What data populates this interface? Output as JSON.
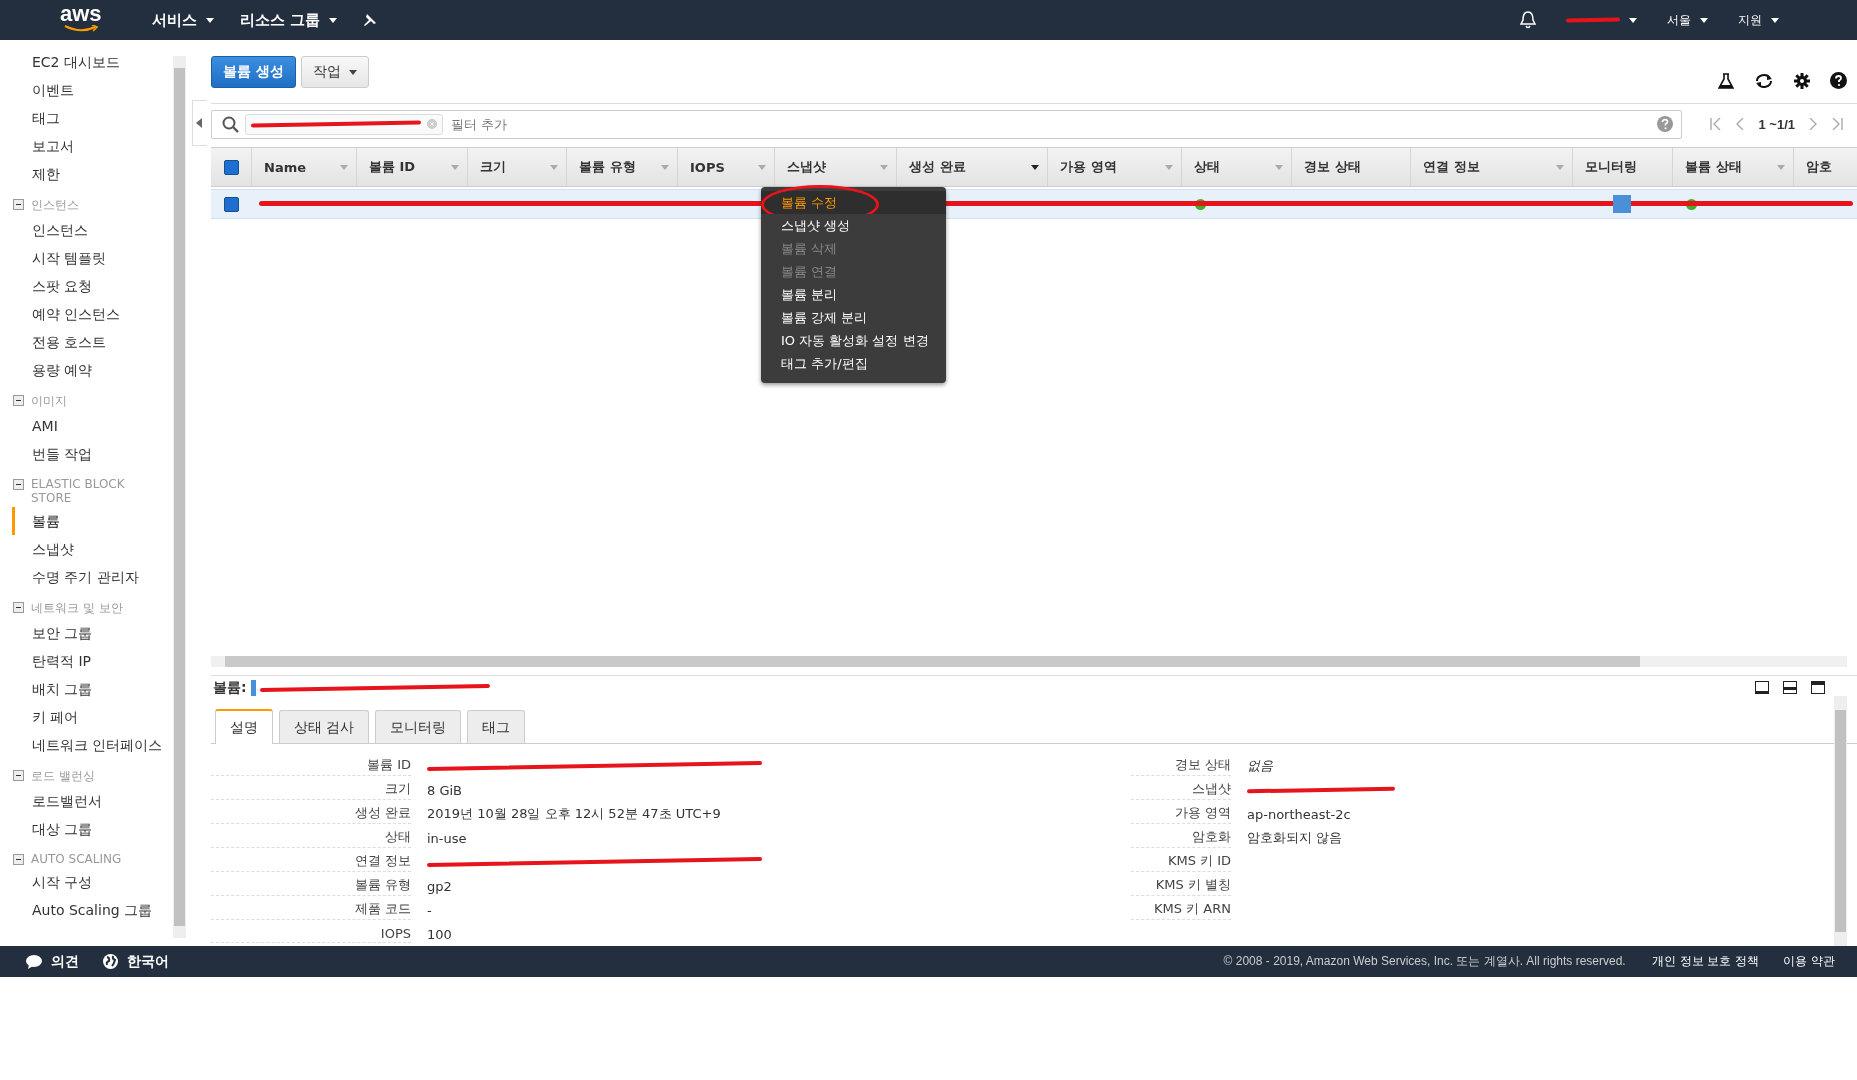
{
  "top_nav": {
    "logo": "aws",
    "menus": [
      {
        "label": "서비스"
      },
      {
        "label": "리소스 그룹"
      }
    ],
    "account": {
      "redacted": true
    },
    "region": "서울",
    "support": "지원"
  },
  "sidebar": {
    "sections": [
      {
        "items": [
          {
            "label": "EC2 대시보드",
            "selected": false
          },
          {
            "label": "이벤트",
            "selected": false
          },
          {
            "label": "태그",
            "selected": false
          },
          {
            "label": "보고서",
            "selected": false
          },
          {
            "label": "제한",
            "selected": false
          }
        ]
      },
      {
        "heading": "인스턴스",
        "items": [
          {
            "label": "인스턴스",
            "selected": false
          },
          {
            "label": "시작 템플릿",
            "selected": false
          },
          {
            "label": "스팟 요청",
            "selected": false
          },
          {
            "label": "예약 인스턴스",
            "selected": false
          },
          {
            "label": "전용 호스트",
            "selected": false
          },
          {
            "label": "용량 예약",
            "selected": false
          }
        ]
      },
      {
        "heading": "이미지",
        "items": [
          {
            "label": "AMI",
            "selected": false
          },
          {
            "label": "번들 작업",
            "selected": false
          }
        ]
      },
      {
        "heading": "ELASTIC BLOCK STORE",
        "items": [
          {
            "label": "볼륨",
            "selected": true
          },
          {
            "label": "스냅샷",
            "selected": false
          },
          {
            "label": "수명 주기 관리자",
            "selected": false
          }
        ]
      },
      {
        "heading": "네트워크 및 보안",
        "items": [
          {
            "label": "보안 그룹",
            "selected": false
          },
          {
            "label": "탄력적 IP",
            "selected": false
          },
          {
            "label": "배치 그룹",
            "selected": false
          },
          {
            "label": "키 페어",
            "selected": false
          },
          {
            "label": "네트워크 인터페이스",
            "selected": false
          }
        ]
      },
      {
        "heading": "로드 밸런싱",
        "items": [
          {
            "label": "로드밸런서",
            "selected": false
          },
          {
            "label": "대상 그룹",
            "selected": false
          }
        ]
      },
      {
        "heading": "AUTO SCALING",
        "items": [
          {
            "label": "시작 구성",
            "selected": false
          },
          {
            "label": "Auto Scaling 그룹",
            "selected": false
          }
        ]
      }
    ]
  },
  "toolbar": {
    "buttons": [
      {
        "label": "볼륨 생성",
        "kind": "primary"
      },
      {
        "label": "작업",
        "kind": "dropdown"
      }
    ]
  },
  "search": {
    "token_redacted": true,
    "placeholder": "필터 추가",
    "pagination": "1 ~1/1"
  },
  "table": {
    "select_all_checked": true,
    "columns": [
      {
        "label": "Name",
        "sortable": true,
        "sorted": false
      },
      {
        "label": "볼륨 ID",
        "sortable": true,
        "sorted": false
      },
      {
        "label": "크기",
        "sortable": true,
        "sorted": false
      },
      {
        "label": "볼륨 유형",
        "sortable": true,
        "sorted": false
      },
      {
        "label": "IOPS",
        "sortable": true,
        "sorted": false
      },
      {
        "label": "스냅샷",
        "sortable": true,
        "sorted": false
      },
      {
        "label": "생성 완료",
        "sortable": true,
        "sorted": true
      },
      {
        "label": "가용 영역",
        "sortable": true,
        "sorted": false
      },
      {
        "label": "상태",
        "sortable": true,
        "sorted": false
      },
      {
        "label": "경보 상태",
        "sortable": false,
        "sorted": false
      },
      {
        "label": "연결 정보",
        "sortable": true,
        "sorted": false
      },
      {
        "label": "모니터링",
        "sortable": false,
        "sorted": false
      },
      {
        "label": "볼륨 상태",
        "sortable": true,
        "sorted": false
      },
      {
        "label": "암호",
        "sortable": false,
        "sorted": false
      }
    ],
    "rows": [
      {
        "selected": true,
        "redacted": true,
        "state": {
          "color": "#3fae29"
        },
        "volume_status": {
          "color": "#3fae29"
        }
      }
    ]
  },
  "context_menu": {
    "items": [
      {
        "label": "볼륨 수정",
        "disabled": false,
        "highlighted": true
      },
      {
        "label": "스냅샷 생성",
        "disabled": false,
        "highlighted": false
      },
      {
        "label": "볼륨 삭제",
        "disabled": true,
        "highlighted": false
      },
      {
        "label": "볼륨 연결",
        "disabled": true,
        "highlighted": false
      },
      {
        "label": "볼륨 분리",
        "disabled": false,
        "highlighted": false
      },
      {
        "label": "볼륨 강제 분리",
        "disabled": false,
        "highlighted": false
      },
      {
        "label": "IO 자동 활성화 설정 변경",
        "disabled": false,
        "highlighted": false
      },
      {
        "label": "태그 추가/편집",
        "disabled": false,
        "highlighted": false
      }
    ]
  },
  "detail": {
    "title": "볼륨:",
    "title_redacted": true,
    "tabs": [
      {
        "label": "설명",
        "selected": true
      },
      {
        "label": "상태 검사",
        "selected": false
      },
      {
        "label": "모니터링",
        "selected": false
      },
      {
        "label": "태그",
        "selected": false
      }
    ],
    "left_fields": [
      {
        "label": "볼륨 ID",
        "kind": "redacted"
      },
      {
        "label": "크기",
        "kind": "text",
        "value": "8 GiB"
      },
      {
        "label": "생성 완료",
        "kind": "text",
        "value": "2019년 10월 28일 오후 12시 52분 47초 UTC+9"
      },
      {
        "label": "상태",
        "kind": "text",
        "value": "in-use"
      },
      {
        "label": "연결 정보",
        "kind": "redacted"
      },
      {
        "label": "볼륨 유형",
        "kind": "text",
        "value": "gp2"
      },
      {
        "label": "제품 코드",
        "kind": "text",
        "value": "-"
      },
      {
        "label": "IOPS",
        "kind": "text",
        "value": "100"
      }
    ],
    "right_fields": [
      {
        "label": "경보 상태",
        "kind": "italic",
        "value": "없음"
      },
      {
        "label": "스냅샷",
        "kind": "redacted"
      },
      {
        "label": "가용 영역",
        "kind": "text",
        "value": "ap-northeast-2c"
      },
      {
        "label": "암호화",
        "kind": "text",
        "value": "암호화되지 않음"
      },
      {
        "label": "KMS 키 ID",
        "kind": "empty"
      },
      {
        "label": "KMS 키 별칭",
        "kind": "empty"
      },
      {
        "label": "KMS 키 ARN",
        "kind": "empty"
      }
    ]
  },
  "footer": {
    "feedback": "의견",
    "language": "한국어",
    "copyright": "© 2008 - 2019, Amazon Web Services, Inc. 또는 계열사. All rights reserved.",
    "links": [
      "개인 정보 보호 정책",
      "이용 약관"
    ]
  }
}
